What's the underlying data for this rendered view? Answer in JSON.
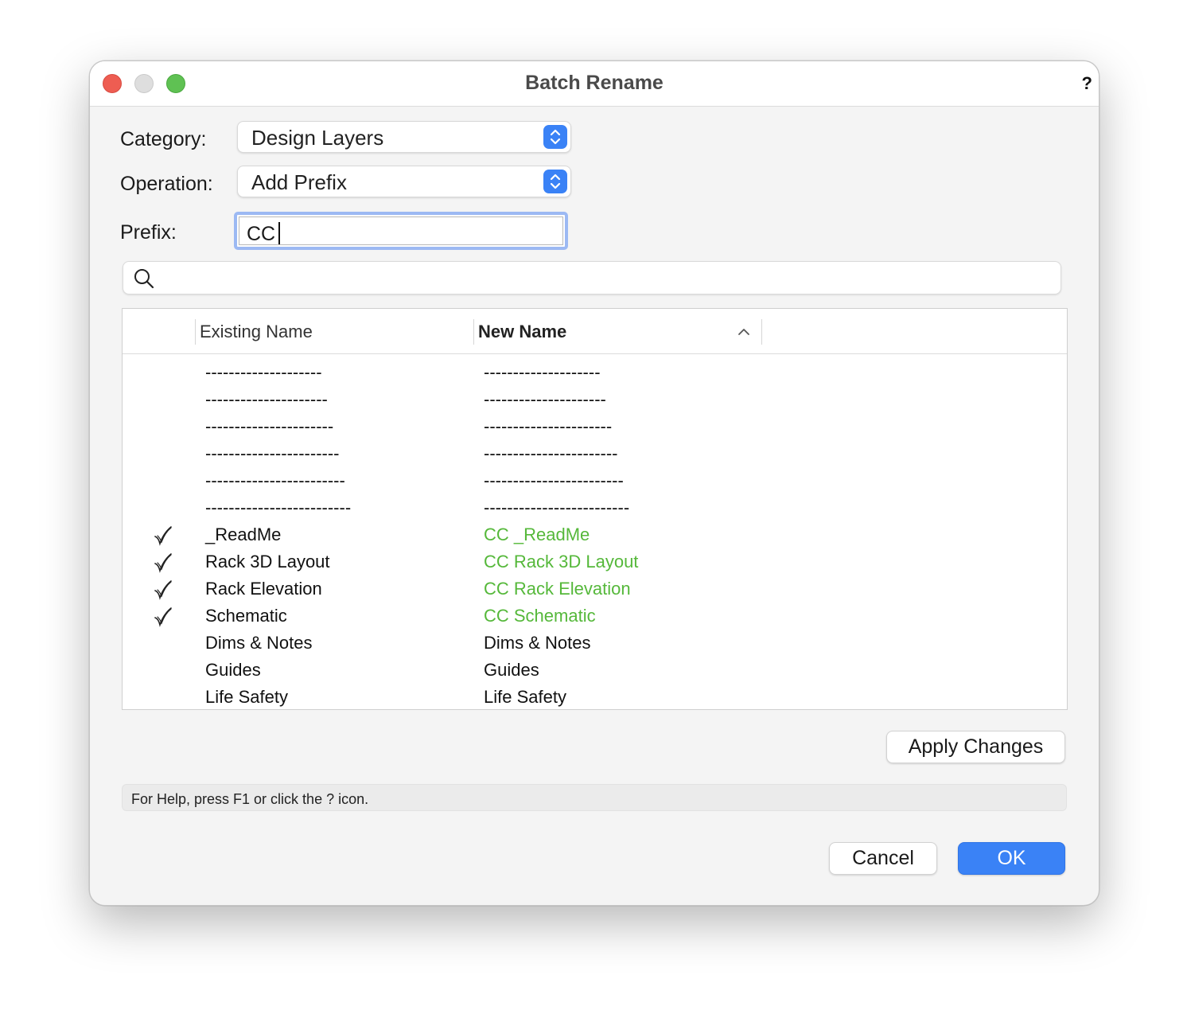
{
  "window": {
    "title": "Batch Rename",
    "help_label": "?"
  },
  "form": {
    "category_label": "Category:",
    "category_value": "Design Layers",
    "operation_label": "Operation:",
    "operation_value": "Add Prefix",
    "prefix_label": "Prefix:",
    "prefix_value": "CC"
  },
  "search": {
    "placeholder": "",
    "icon": "search-icon"
  },
  "table": {
    "columns": [
      "Existing Name",
      "New Name"
    ],
    "sort_indicator": "chevron-up-icon",
    "rows": [
      {
        "checked": false,
        "existing": "--------------------",
        "new": "--------------------",
        "changed": false
      },
      {
        "checked": false,
        "existing": "---------------------",
        "new": "---------------------",
        "changed": false
      },
      {
        "checked": false,
        "existing": "----------------------",
        "new": "----------------------",
        "changed": false
      },
      {
        "checked": false,
        "existing": "-----------------------",
        "new": "-----------------------",
        "changed": false
      },
      {
        "checked": false,
        "existing": "------------------------",
        "new": "------------------------",
        "changed": false
      },
      {
        "checked": false,
        "existing": "-------------------------",
        "new": "-------------------------",
        "changed": false
      },
      {
        "checked": true,
        "existing": "_ReadMe",
        "new": "CC _ReadMe",
        "changed": true
      },
      {
        "checked": true,
        "existing": "Rack 3D Layout",
        "new": "CC Rack 3D Layout",
        "changed": true
      },
      {
        "checked": true,
        "existing": "Rack Elevation",
        "new": "CC Rack Elevation",
        "changed": true
      },
      {
        "checked": true,
        "existing": "Schematic",
        "new": "CC Schematic",
        "changed": true
      },
      {
        "checked": false,
        "existing": "Dims & Notes",
        "new": "Dims & Notes",
        "changed": false
      },
      {
        "checked": false,
        "existing": "Guides",
        "new": "Guides",
        "changed": false
      },
      {
        "checked": false,
        "existing": "Life Safety",
        "new": "Life Safety",
        "changed": false
      }
    ]
  },
  "buttons": {
    "apply": "Apply Changes",
    "cancel": "Cancel",
    "ok": "OK"
  },
  "status_text": "For Help, press F1 or click the ? icon.",
  "colors": {
    "accent": "#3a82f6",
    "changed_text": "#55b83a",
    "close": "#ee5d52",
    "maximize": "#5fc153"
  }
}
